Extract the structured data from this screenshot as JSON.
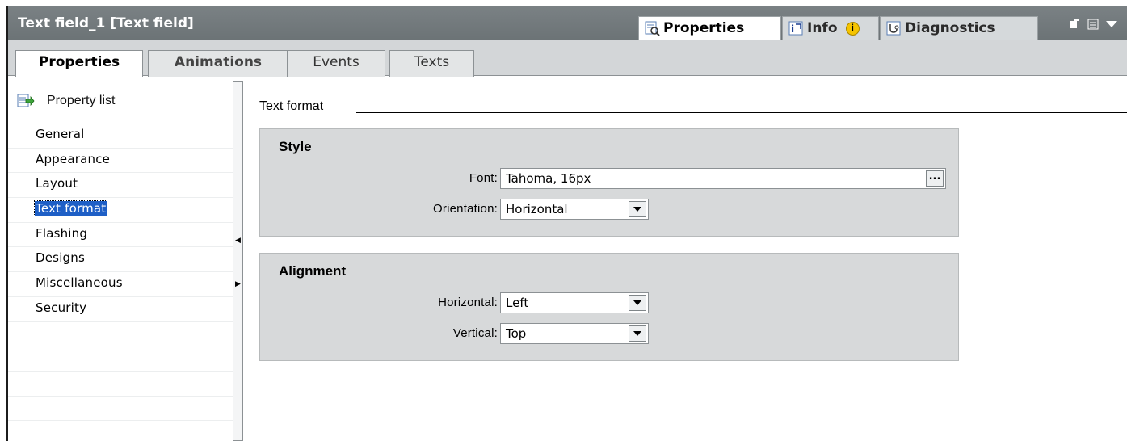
{
  "window": {
    "title": "Text field_1 [Text field]",
    "panel_tabs": [
      {
        "label": "Properties",
        "icon": "properties-icon",
        "active": true
      },
      {
        "label": "Info",
        "icon": "info-icon",
        "badge": "i",
        "active": false
      },
      {
        "label": "Diagnostics",
        "icon": "diagnostics-icon",
        "active": false
      }
    ]
  },
  "main_tabs": [
    {
      "label": "Properties",
      "active": true
    },
    {
      "label": "Animations",
      "active": false
    },
    {
      "label": "Events",
      "active": false
    },
    {
      "label": "Texts",
      "active": false
    }
  ],
  "sidebar": {
    "property_list_label": "Property list",
    "items": [
      {
        "label": "General",
        "selected": false
      },
      {
        "label": "Appearance",
        "selected": false
      },
      {
        "label": "Layout",
        "selected": false
      },
      {
        "label": "Text format",
        "selected": true
      },
      {
        "label": "Flashing",
        "selected": false
      },
      {
        "label": "Designs",
        "selected": false
      },
      {
        "label": "Miscellaneous",
        "selected": false
      },
      {
        "label": "Security",
        "selected": false
      }
    ]
  },
  "content": {
    "section_title": "Text format",
    "style_group": {
      "title": "Style",
      "font_label": "Font:",
      "font_value": "Tahoma, 16px",
      "font_button": "...",
      "orientation_label": "Orientation:",
      "orientation_value": "Horizontal"
    },
    "alignment_group": {
      "title": "Alignment",
      "horizontal_label": "Horizontal:",
      "horizontal_value": "Left",
      "vertical_label": "Vertical:",
      "vertical_value": "Top"
    }
  },
  "colors": {
    "titlebar": "#6c7376",
    "selection": "#1e5fc6",
    "info_badge": "#f5c400",
    "group_bg": "#d7d9da"
  }
}
